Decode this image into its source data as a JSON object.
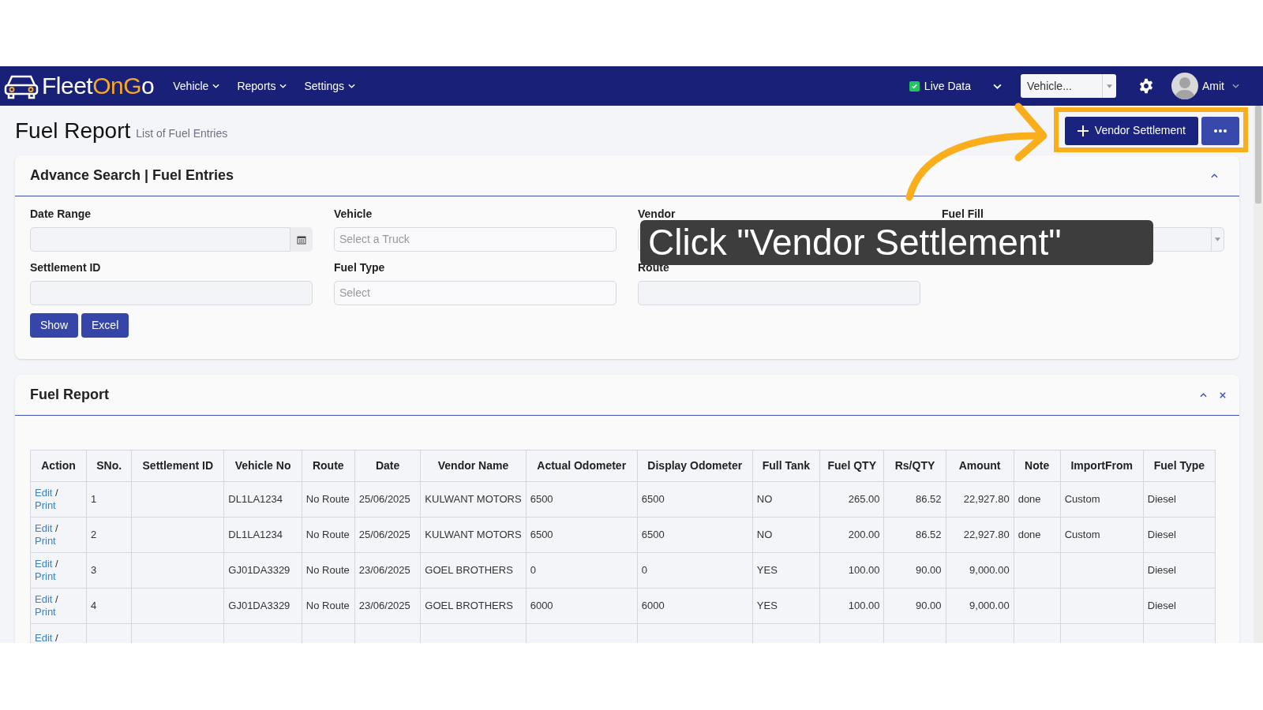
{
  "navbar": {
    "logo": {
      "parts": [
        {
          "text": "Fleet",
          "color": "#ffffff"
        },
        {
          "text": "On",
          "color": "#f9a825"
        },
        {
          "text": "G",
          "color": "#f9a825"
        },
        {
          "text": "o",
          "color": "#ffffff"
        }
      ]
    },
    "menus": [
      {
        "label": "Vehicle"
      },
      {
        "label": "Reports"
      },
      {
        "label": "Settings"
      }
    ],
    "live_data": {
      "label": "Live Data",
      "checked": true
    },
    "vehicle_select": {
      "value": "Vehicle..."
    },
    "user": {
      "name": "Amit"
    }
  },
  "page": {
    "title": "Fuel Report",
    "subtitle": "List of Fuel Entries",
    "primary_button": "Vendor Settlement"
  },
  "search_card": {
    "title": "Advance Search | Fuel Entries",
    "expanded": true,
    "fields": [
      {
        "label": "Date Range",
        "kind": "date"
      },
      {
        "label": "Vehicle",
        "kind": "select",
        "placeholder": "Select a Truck"
      },
      {
        "label": "Vendor",
        "kind": "select"
      },
      {
        "label": "Fuel Fill",
        "kind": "dropdown"
      },
      {
        "label": "Settlement ID",
        "kind": "text"
      },
      {
        "label": "Fuel Type",
        "kind": "select",
        "placeholder": "Select"
      },
      {
        "label": "Route",
        "kind": "text"
      }
    ],
    "buttons": [
      "Show",
      "Excel"
    ]
  },
  "report_card": {
    "title": "Fuel Report",
    "expanded": true,
    "table": {
      "columns": [
        "Action",
        "SNo.",
        "Settlement ID",
        "Vehicle No",
        "Route",
        "Date",
        "Vendor Name",
        "Actual Odometer",
        "Display Odometer",
        "Full Tank",
        "Fuel QTY",
        "Rs/QTY",
        "Amount",
        "Note",
        "ImportFrom",
        "Fuel Type"
      ],
      "rows": [
        {
          "cells": [
            {
              "links": [
                "Edit",
                "Print"
              ],
              "separator": "/"
            },
            "1",
            "",
            "DL1LA1234",
            "No Route",
            "25/06/2025",
            "KULWANT MOTORS",
            "6500",
            "6500",
            "NO",
            "265.00",
            "86.52",
            "22,927.80",
            "done",
            "Custom",
            "Diesel"
          ]
        },
        {
          "cells": [
            {
              "links": [
                "Edit",
                "Print"
              ],
              "separator": "/"
            },
            "2",
            "",
            "DL1LA1234",
            "No Route",
            "25/06/2025",
            "KULWANT MOTORS",
            "6500",
            "6500",
            "NO",
            "200.00",
            "86.52",
            "22,927.80",
            "done",
            "Custom",
            "Diesel"
          ]
        },
        {
          "cells": [
            {
              "links": [
                "Edit",
                "Print"
              ],
              "separator": "/"
            },
            "3",
            "",
            "GJ01DA3329",
            "No Route",
            "23/06/2025",
            "GOEL BROTHERS",
            "0",
            "0",
            "YES",
            "100.00",
            "90.00",
            "9,000.00",
            "",
            "",
            "Diesel"
          ]
        },
        {
          "cells": [
            {
              "links": [
                "Edit",
                "Print"
              ],
              "separator": "/"
            },
            "4",
            "",
            "GJ01DA3329",
            "No Route",
            "23/06/2025",
            "GOEL BROTHERS",
            "6000",
            "6000",
            "YES",
            "100.00",
            "90.00",
            "9,000.00",
            "",
            "",
            "Diesel"
          ]
        },
        {
          "cells": [
            {
              "links": [
                "Edit"
              ],
              "separator": "/"
            },
            "",
            "",
            "",
            "",
            "",
            "",
            "",
            "",
            "",
            "",
            "",
            "",
            "",
            "",
            ""
          ]
        }
      ]
    }
  },
  "callout": {
    "text": "Click \"Vendor Settlement\""
  }
}
